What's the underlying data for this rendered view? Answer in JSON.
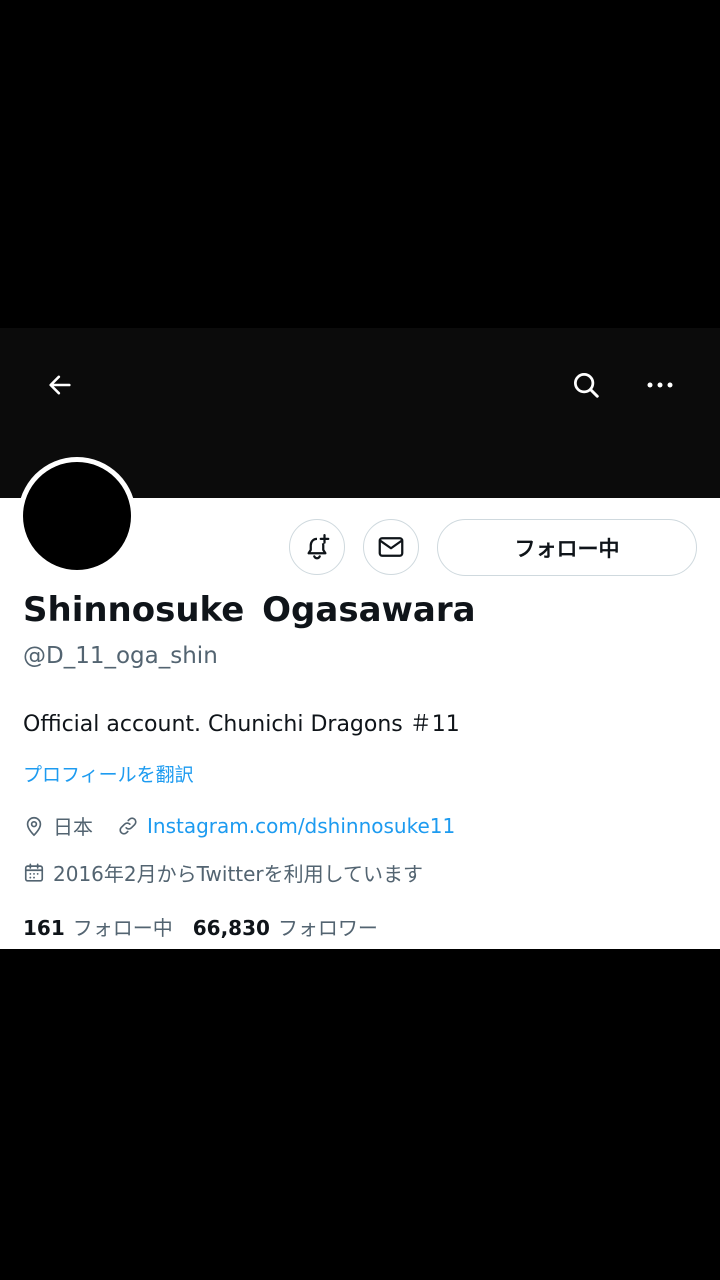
{
  "header": {
    "back_icon": "arrow-left-icon",
    "search_icon": "search-icon",
    "more_icon": "more-horizontal-icon"
  },
  "actions": {
    "notify_icon": "bell-plus-icon",
    "message_icon": "mail-icon",
    "follow_label": "フォロー中"
  },
  "profile": {
    "name": "Shinnosuke  Ogasawara",
    "handle": "@D_11_oga_shin",
    "bio": "Official account. Chunichi Dragons ＃11",
    "translate": "プロフィールを翻訳",
    "location": "日本",
    "url": "Instagram.com/dshinnosuke11",
    "joined": "2016年2月からTwitterを利用しています"
  },
  "stats": {
    "following_count": "161",
    "following_label": "フォロー中",
    "followers_count": "66,830",
    "followers_label": "フォロワー"
  },
  "colors": {
    "link": "#1d9bf0",
    "text": "#0f1419",
    "muted": "#536471",
    "border": "#cfd9de"
  }
}
